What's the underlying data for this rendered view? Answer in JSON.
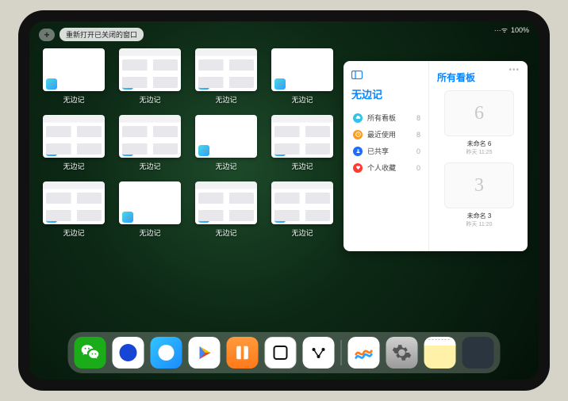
{
  "status": {
    "battery": "100%",
    "wifi": "···ᯤ"
  },
  "topbar": {
    "plus": "+",
    "reopen_label": "重新打开已关闭的窗口"
  },
  "app": {
    "name": "无边记",
    "thumbs": [
      {
        "kind": "blank"
      },
      {
        "kind": "grid"
      },
      {
        "kind": "grid"
      },
      {
        "kind": "blank"
      },
      {
        "kind": "grid"
      },
      {
        "kind": "grid"
      },
      {
        "kind": "blank"
      },
      {
        "kind": "grid"
      },
      {
        "kind": "grid"
      },
      {
        "kind": "blank"
      },
      {
        "kind": "grid"
      },
      {
        "kind": "grid"
      }
    ]
  },
  "panel": {
    "title": "无边记",
    "right_title": "所有看板",
    "items": [
      {
        "icon": "cloud",
        "color": "#34c3e8",
        "label": "所有看板",
        "count": "8"
      },
      {
        "icon": "clock",
        "color": "#ff9a1a",
        "label": "最近使用",
        "count": "8"
      },
      {
        "icon": "person",
        "color": "#1e6bff",
        "label": "已共享",
        "count": "0"
      },
      {
        "icon": "heart",
        "color": "#ff3b30",
        "label": "个人收藏",
        "count": "0"
      }
    ],
    "boards": [
      {
        "glyph": "6",
        "name": "未命名 6",
        "sub": "昨天 11:25"
      },
      {
        "glyph": "3",
        "name": "未命名 3",
        "sub": "昨天 11:20"
      }
    ]
  },
  "dock": {
    "icons": [
      {
        "name": "wechat"
      },
      {
        "name": "dot1"
      },
      {
        "name": "dot2"
      },
      {
        "name": "play"
      },
      {
        "name": "books"
      },
      {
        "name": "square"
      },
      {
        "name": "dots3"
      }
    ],
    "icons_right": [
      {
        "name": "freeform"
      },
      {
        "name": "settings"
      },
      {
        "name": "notes"
      },
      {
        "name": "multi"
      }
    ]
  }
}
